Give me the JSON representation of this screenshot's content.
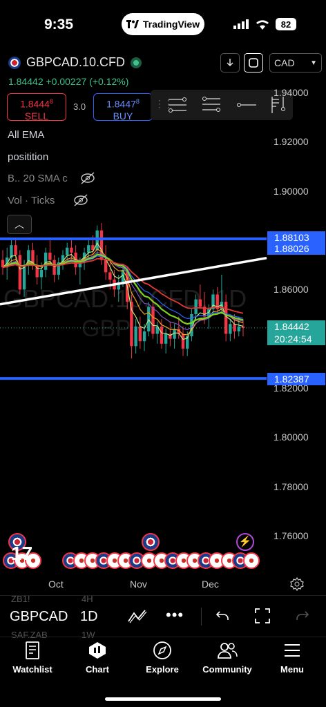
{
  "status": {
    "time": "9:35",
    "app_pill": "TradingView",
    "battery": "82"
  },
  "header": {
    "symbol": "GBPCAD.10.CFD",
    "last_price": "1.84442",
    "change": "+0.00227",
    "change_pct": "(+0.12%)",
    "currency": "CAD"
  },
  "trade": {
    "sell_price": "1.8444",
    "sell_sup": "8",
    "sell_label": "SELL",
    "spread": "3.0",
    "buy_price": "1.8447",
    "buy_sup": "8",
    "buy_label": "BUY"
  },
  "indicators": [
    {
      "label": "All EMA"
    },
    {
      "label": "positition"
    },
    {
      "label": "B.. 20 SMA c"
    },
    {
      "label": "Vol · Ticks"
    }
  ],
  "watermark": {
    "line1": "GBPCAD.10.CFD, 1D",
    "line2": "GBP"
  },
  "y_axis": {
    "ticks": [
      "1.94000",
      "1.92000",
      "1.90000",
      "1.88000",
      "1.86000",
      "1.84000",
      "1.82000",
      "1.80000",
      "1.78000",
      "1.76000"
    ],
    "price_labels": [
      {
        "value": "1.88103",
        "color": "#2962ff"
      },
      {
        "value": "1.88026",
        "color": "#2962ff"
      },
      {
        "value": "1.84442",
        "extra": "20:24:54",
        "color": "#26a69a"
      },
      {
        "value": "1.82387",
        "color": "#2962ff"
      }
    ]
  },
  "x_axis": {
    "ticks": [
      "Oct",
      "Nov",
      "Dec"
    ]
  },
  "bottom_toolbar": {
    "symbol": "GBPCAD",
    "interval": "1D",
    "ghost_symbols": [
      "ZB1!",
      "SAF.ZAB"
    ],
    "ghost_intervals": [
      "4H",
      "1W"
    ]
  },
  "tabs": [
    {
      "label": "Watchlist",
      "icon": "book-icon"
    },
    {
      "label": "Chart",
      "icon": "chart-icon"
    },
    {
      "label": "Explore",
      "icon": "compass-icon"
    },
    {
      "label": "Community",
      "icon": "people-icon"
    },
    {
      "label": "Menu",
      "icon": "menu-icon"
    }
  ],
  "chart_data": {
    "type": "candlestick",
    "x_ticks": [
      "Oct",
      "Nov",
      "Dec"
    ],
    "ylim": [
      1.75,
      1.945
    ],
    "horizontal_levels": [
      1.8806,
      1.8239
    ],
    "trendline": {
      "from": [
        0,
        1.854
      ],
      "to": [
        1.0,
        1.8728
      ]
    },
    "last_price": 1.84442,
    "candles": [
      [
        1.872,
        1.876,
        1.866,
        1.869
      ],
      [
        1.869,
        1.877,
        1.864,
        1.873
      ],
      [
        1.873,
        1.88,
        1.87,
        1.878
      ],
      [
        1.878,
        1.881,
        1.872,
        1.874
      ],
      [
        1.874,
        1.876,
        1.858,
        1.86
      ],
      [
        1.86,
        1.872,
        1.857,
        1.87
      ],
      [
        1.87,
        1.878,
        1.866,
        1.876
      ],
      [
        1.876,
        1.879,
        1.868,
        1.87
      ],
      [
        1.87,
        1.874,
        1.862,
        1.865
      ],
      [
        1.865,
        1.871,
        1.86,
        1.868
      ],
      [
        1.868,
        1.877,
        1.865,
        1.875
      ],
      [
        1.875,
        1.88,
        1.871,
        1.872
      ],
      [
        1.872,
        1.874,
        1.863,
        1.866
      ],
      [
        1.866,
        1.873,
        1.864,
        1.871
      ],
      [
        1.871,
        1.876,
        1.868,
        1.874
      ],
      [
        1.874,
        1.879,
        1.871,
        1.877
      ],
      [
        1.877,
        1.881,
        1.872,
        1.875
      ],
      [
        1.875,
        1.878,
        1.866,
        1.869
      ],
      [
        1.869,
        1.873,
        1.862,
        1.871
      ],
      [
        1.871,
        1.877,
        1.868,
        1.875
      ],
      [
        1.875,
        1.88,
        1.872,
        1.878
      ],
      [
        1.878,
        1.882,
        1.874,
        1.876
      ],
      [
        1.876,
        1.886,
        1.874,
        1.884
      ],
      [
        1.884,
        1.887,
        1.87,
        1.872
      ],
      [
        1.872,
        1.878,
        1.864,
        1.867
      ],
      [
        1.867,
        1.871,
        1.86,
        1.864
      ],
      [
        1.864,
        1.868,
        1.857,
        1.86
      ],
      [
        1.86,
        1.866,
        1.855,
        1.863
      ],
      [
        1.863,
        1.87,
        1.861,
        1.868
      ],
      [
        1.868,
        1.869,
        1.852,
        1.855
      ],
      [
        1.855,
        1.858,
        1.832,
        1.837
      ],
      [
        1.837,
        1.848,
        1.834,
        1.845
      ],
      [
        1.845,
        1.849,
        1.836,
        1.839
      ],
      [
        1.839,
        1.846,
        1.835,
        1.843
      ],
      [
        1.843,
        1.855,
        1.841,
        1.853
      ],
      [
        1.853,
        1.856,
        1.84,
        1.842
      ],
      [
        1.842,
        1.847,
        1.838,
        1.845
      ],
      [
        1.845,
        1.848,
        1.836,
        1.838
      ],
      [
        1.838,
        1.844,
        1.834,
        1.842
      ],
      [
        1.842,
        1.847,
        1.837,
        1.84
      ],
      [
        1.84,
        1.846,
        1.836,
        1.844
      ],
      [
        1.844,
        1.849,
        1.84,
        1.842
      ],
      [
        1.842,
        1.845,
        1.833,
        1.836
      ],
      [
        1.836,
        1.843,
        1.833,
        1.841
      ],
      [
        1.841,
        1.852,
        1.839,
        1.85
      ],
      [
        1.85,
        1.858,
        1.848,
        1.856
      ],
      [
        1.856,
        1.862,
        1.852,
        1.853
      ],
      [
        1.853,
        1.859,
        1.846,
        1.849
      ],
      [
        1.849,
        1.854,
        1.844,
        1.852
      ],
      [
        1.852,
        1.86,
        1.85,
        1.858
      ],
      [
        1.858,
        1.861,
        1.85,
        1.852
      ],
      [
        1.852,
        1.866,
        1.85,
        1.855
      ],
      [
        1.855,
        1.858,
        1.839,
        1.842
      ],
      [
        1.842,
        1.848,
        1.839,
        1.846
      ],
      [
        1.846,
        1.85,
        1.84,
        1.843
      ],
      [
        1.843,
        1.849,
        1.841,
        1.845
      ],
      [
        1.845,
        1.848,
        1.841,
        1.8444
      ]
    ]
  }
}
